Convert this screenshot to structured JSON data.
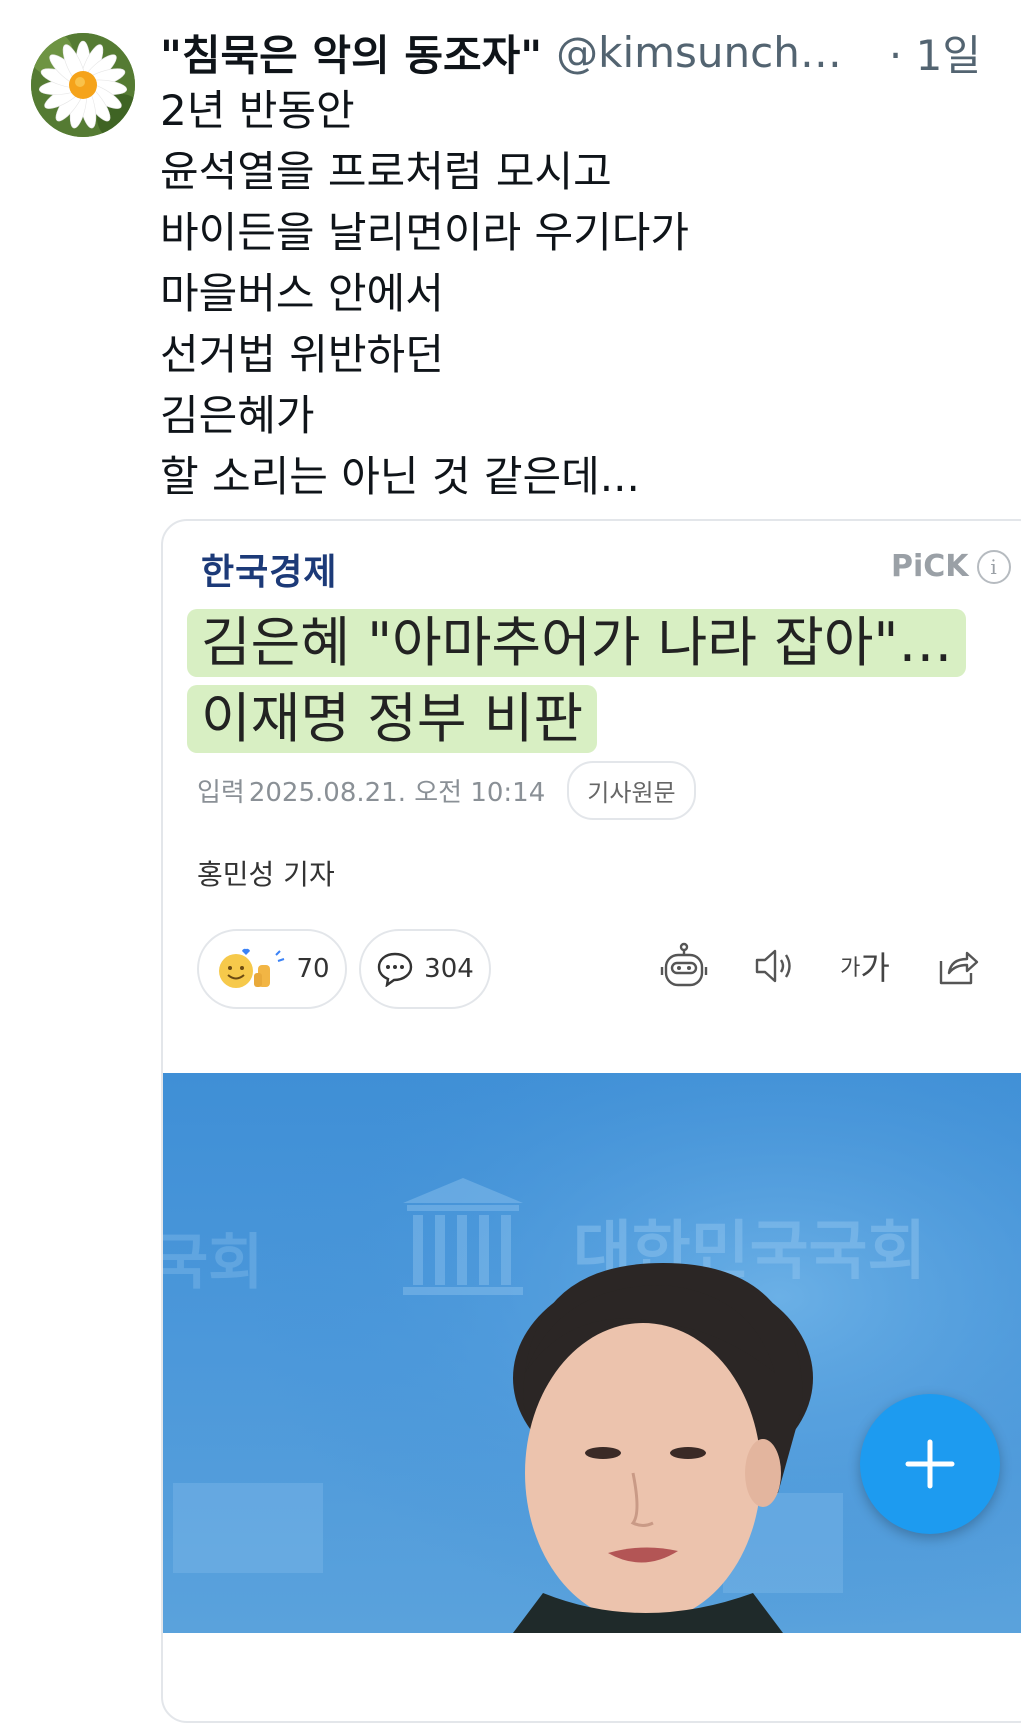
{
  "tweet": {
    "display_name": "\"침묵은 악의 동조자\"",
    "handle": "@kimsunchul...",
    "time": "· 1일",
    "lines": [
      "2년 반동안",
      "윤석열을 프로처럼 모시고",
      "바이든을 날리면이라 우기다가",
      "마을버스 안에서",
      "선거법 위반하던",
      "김은혜가",
      "할 소리는 아닌 것 같은데..."
    ]
  },
  "card": {
    "press_name": "한국경제",
    "pick_label": "PiCK",
    "info_icon": "i",
    "headline_lines": [
      "김은혜 \"아마추어가 나라 잡아\"…",
      "이재명 정부 비판"
    ],
    "input_label": "입력",
    "date": "2025.08.21. 오전 10:14",
    "original_button": "기사원문",
    "reporter": "홍민성 기자",
    "reaction_count": "70",
    "comment_count": "304",
    "font_size_small": "가",
    "font_size_large": "가",
    "photo_backdrop_text": "대한민국국회",
    "photo_backdrop_text_left": "국회"
  },
  "colors": {
    "accent": "#1d9bf0",
    "highlight": "#d8efc3",
    "press": "#1c3a78"
  },
  "icons": [
    "daisy-avatar",
    "info-icon",
    "reaction-emoji-icon",
    "comment-icon",
    "robot-icon",
    "speaker-icon",
    "share-icon",
    "plus-icon"
  ]
}
